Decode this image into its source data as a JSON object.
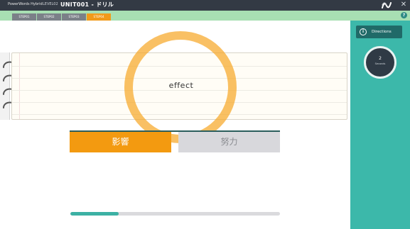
{
  "titlebar": {
    "app_name": "PowerWords Hybrid",
    "level": "LEVEL02",
    "unit_title": "UNIT001 - ドリル"
  },
  "tabs": [
    {
      "label": "STEP01",
      "active": false
    },
    {
      "label": "STEP02",
      "active": false
    },
    {
      "label": "STEP03",
      "active": false
    },
    {
      "label": "STEP04",
      "active": true
    }
  ],
  "help": {
    "label": "?"
  },
  "sidebar": {
    "directions_label": "Directions",
    "info_glyph": "i",
    "timer_value": "2",
    "timer_unit": "Seconds"
  },
  "question": {
    "word": "effect"
  },
  "answers": [
    {
      "label": "影響",
      "selected": true
    },
    {
      "label": "努力",
      "selected": false
    }
  ],
  "progress": {
    "fraction": 0.23
  },
  "colors": {
    "titlebar": "#333a44",
    "tabbar": "#a8dfb3",
    "sidebar": "#3cb8aa",
    "accent_orange": "#f39a10",
    "progress_fill": "#3cb1a4"
  },
  "icons": {
    "close": "close-icon",
    "logo": "app-logo-icon",
    "help": "help-icon",
    "info": "info-icon",
    "rings": "notebook-ring-icon"
  }
}
